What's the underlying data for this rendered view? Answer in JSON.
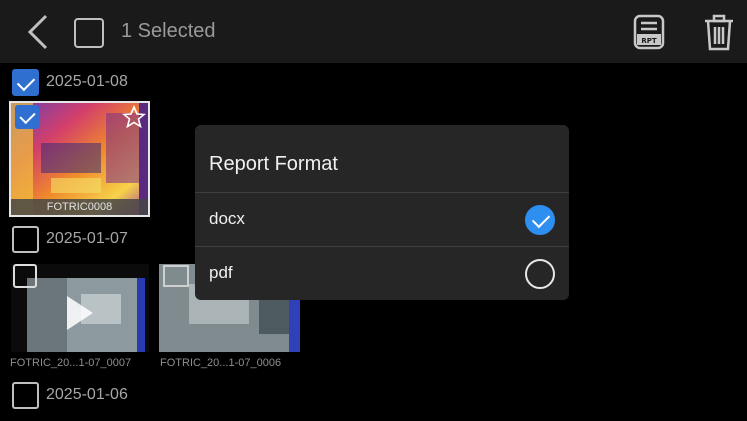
{
  "header": {
    "selected_label": "1 Selected",
    "back_icon": "chevron-left-icon",
    "report_icon": "report-icon",
    "report_icon_text": "RPT",
    "delete_icon": "trash-icon"
  },
  "gallery": {
    "groups": [
      {
        "date": "2025-01-08",
        "checked": true
      },
      {
        "date": "2025-01-07",
        "checked": false
      },
      {
        "date": "2025-01-06",
        "checked": false
      }
    ],
    "items": [
      {
        "caption": "FOTRIC0008",
        "selected": true,
        "type": "thermal-image"
      },
      {
        "caption": "FOTRIC_20...1-07_0007",
        "selected": false,
        "type": "video"
      },
      {
        "caption": "FOTRIC_20...1-07_0006",
        "selected": false,
        "type": "image"
      }
    ]
  },
  "dialog": {
    "title": "Report Format",
    "options": [
      {
        "label": "docx",
        "selected": true
      },
      {
        "label": "pdf",
        "selected": false
      }
    ]
  },
  "colors": {
    "accent": "#2e8ff0",
    "checkbox_selected": "#2f6fcf",
    "dialog_bg": "#262626"
  }
}
